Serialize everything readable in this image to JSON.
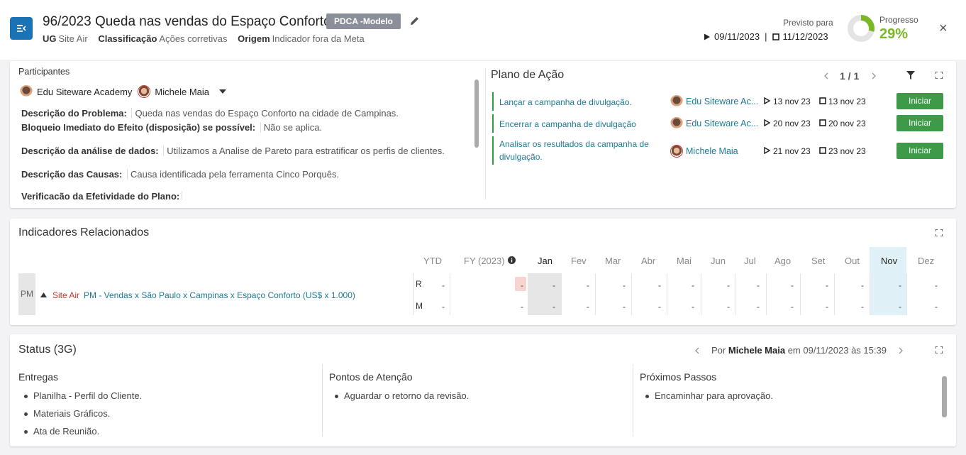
{
  "header": {
    "title": "96/2023 Queda nas vendas do Espaço Conforto",
    "badge": "PDCA -Modelo",
    "ug_label": "UG",
    "ug_value": "Site Air",
    "class_label": "Classificação",
    "class_value": "Ações corretivas",
    "origin_label": "Origem",
    "origin_value": "Indicador fora da Meta",
    "planned_label": "Previsto para",
    "start_date": "09/11/2023",
    "separator": "|",
    "end_date": "11/12/2023",
    "progress_label": "Progresso",
    "progress_value": "29%",
    "progress_fraction": 0.29,
    "close_symbol": "×"
  },
  "participants": {
    "label": "Participantes",
    "people": [
      "Edu Siteware Academy",
      "Michele Maia"
    ]
  },
  "descriptions": [
    {
      "label": "Descrição do Problema:",
      "value": "Queda nas vendas do Espaço Conforto na cidade de Campinas."
    },
    {
      "label": "Bloqueio Imediato do Efeito (disposição) se possível:",
      "value": "Não se aplica."
    },
    {
      "label": "Descrição da análise de dados:",
      "value": "Utilizamos a Analise de Pareto para estratificar os perfis de clientes."
    },
    {
      "label": "Descrição das Causas:",
      "value": "Causa identificada pela ferramenta Cinco Porquês."
    },
    {
      "label": "Verificação da Efetividade do Plano:",
      "value": ""
    }
  ],
  "plan": {
    "title": "Plano de Ação",
    "pager": "1 / 1",
    "button_label": "Iniciar",
    "rows": [
      {
        "task": "Lançar a campanha de divulgação.",
        "responsible": "Edu Siteware Ac...",
        "start": "13 nov 23",
        "end": "13 nov 23"
      },
      {
        "task": "Encerrar a campanha de divulgação",
        "responsible": "Edu Siteware Ac...",
        "start": "20 nov 23",
        "end": "20 nov 23"
      },
      {
        "task": "Analisar os resultados da campanha de divulgação.",
        "responsible": "Michele Maia",
        "start": "21 nov 23",
        "end": "23 nov 23"
      }
    ]
  },
  "indicators": {
    "title": "Indicadores Relacionados",
    "columns": [
      "YTD",
      "FY (2023)",
      "Jan",
      "Fev",
      "Mar",
      "Abr",
      "Mai",
      "Jun",
      "Jul",
      "Ago",
      "Set",
      "Out",
      "Nov",
      "Dez"
    ],
    "row_badge": "PM",
    "unit": "Site Air",
    "name": "PM - Vendas x São Paulo x Campinas x Espaço Conforto (US$ x 1.000)",
    "row_r": "R",
    "row_m": "M",
    "cell": "-"
  },
  "status": {
    "title": "Status (3G)",
    "by_prefix": "Por",
    "author": "Michele Maia",
    "date_text": "em 09/11/2023 às 15:39",
    "columns": [
      {
        "title": "Entregas",
        "items": [
          "Planilha - Perfil do Cliente.",
          "Materiais Gráficos.",
          "Ata de Reunião."
        ]
      },
      {
        "title": "Pontos de Atenção",
        "items": [
          "Aguardar o retorno da revisão."
        ]
      },
      {
        "title": "Próximos Passos",
        "items": [
          "Encaminhar para aprovação."
        ]
      }
    ]
  },
  "colors": {
    "accent": "#1a73b5",
    "progress": "#7ab828",
    "button": "#3c9a48",
    "link": "#1d7a93",
    "highlight": "#dff0f6"
  }
}
